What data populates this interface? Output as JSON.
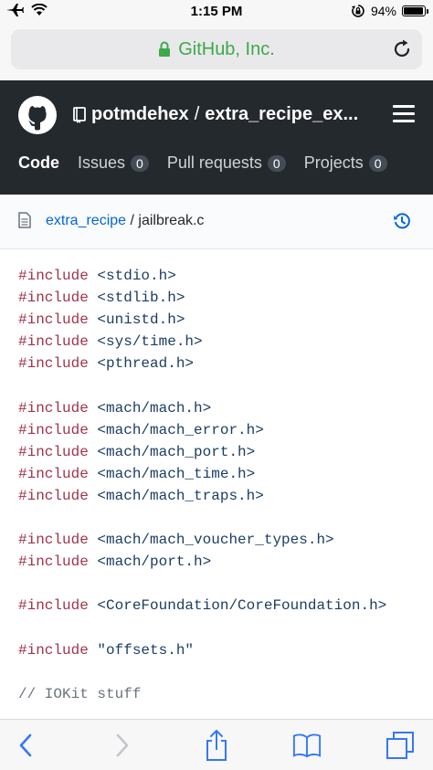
{
  "status_bar": {
    "time": "1:15 PM",
    "battery": "94%",
    "battery_level": 0.94,
    "icons": [
      "airplane-icon",
      "wifi-icon",
      "rotation-lock-icon",
      "battery-icon"
    ]
  },
  "safari": {
    "address": "GitHub, Inc.",
    "lock_color": "#3ea84b",
    "toolbar_icons": [
      "back-icon",
      "forward-icon",
      "share-icon",
      "bookmarks-icon",
      "tabs-icon"
    ]
  },
  "github": {
    "owner": "potmdehex",
    "separator": "/",
    "repo": "extra_recipe_ex...",
    "tabs": [
      {
        "label": "Code",
        "count": ""
      },
      {
        "label": "Issues",
        "count": "0"
      },
      {
        "label": "Pull requests",
        "count": "0"
      },
      {
        "label": "Projects",
        "count": "0"
      }
    ]
  },
  "breadcrumb": {
    "folder": "extra_recipe",
    "separator": " / ",
    "file": "jailbreak.c"
  },
  "code": {
    "lines": [
      {
        "kw": "#include",
        "rest": " <stdio.h>"
      },
      {
        "kw": "#include",
        "rest": " <stdlib.h>"
      },
      {
        "kw": "#include",
        "rest": " <unistd.h>"
      },
      {
        "kw": "#include",
        "rest": " <sys/time.h>"
      },
      {
        "kw": "#include",
        "rest": " <pthread.h>"
      },
      {
        "kw": "",
        "rest": ""
      },
      {
        "kw": "#include",
        "rest": " <mach/mach.h>"
      },
      {
        "kw": "#include",
        "rest": " <mach/mach_error.h>"
      },
      {
        "kw": "#include",
        "rest": " <mach/mach_port.h>"
      },
      {
        "kw": "#include",
        "rest": " <mach/mach_time.h>"
      },
      {
        "kw": "#include",
        "rest": " <mach/mach_traps.h>"
      },
      {
        "kw": "",
        "rest": ""
      },
      {
        "kw": "#include",
        "rest": " <mach/mach_voucher_types.h>"
      },
      {
        "kw": "#include",
        "rest": " <mach/port.h>"
      },
      {
        "kw": "",
        "rest": ""
      },
      {
        "kw": "#include",
        "rest": " <CoreFoundation/CoreFoundation.h>"
      },
      {
        "kw": "",
        "rest": ""
      },
      {
        "kw": "#include",
        "rest": " \"offsets.h\""
      },
      {
        "kw": "",
        "rest": ""
      },
      {
        "kw": "",
        "rest": "// IOKit stuff",
        "comment": true
      }
    ]
  }
}
